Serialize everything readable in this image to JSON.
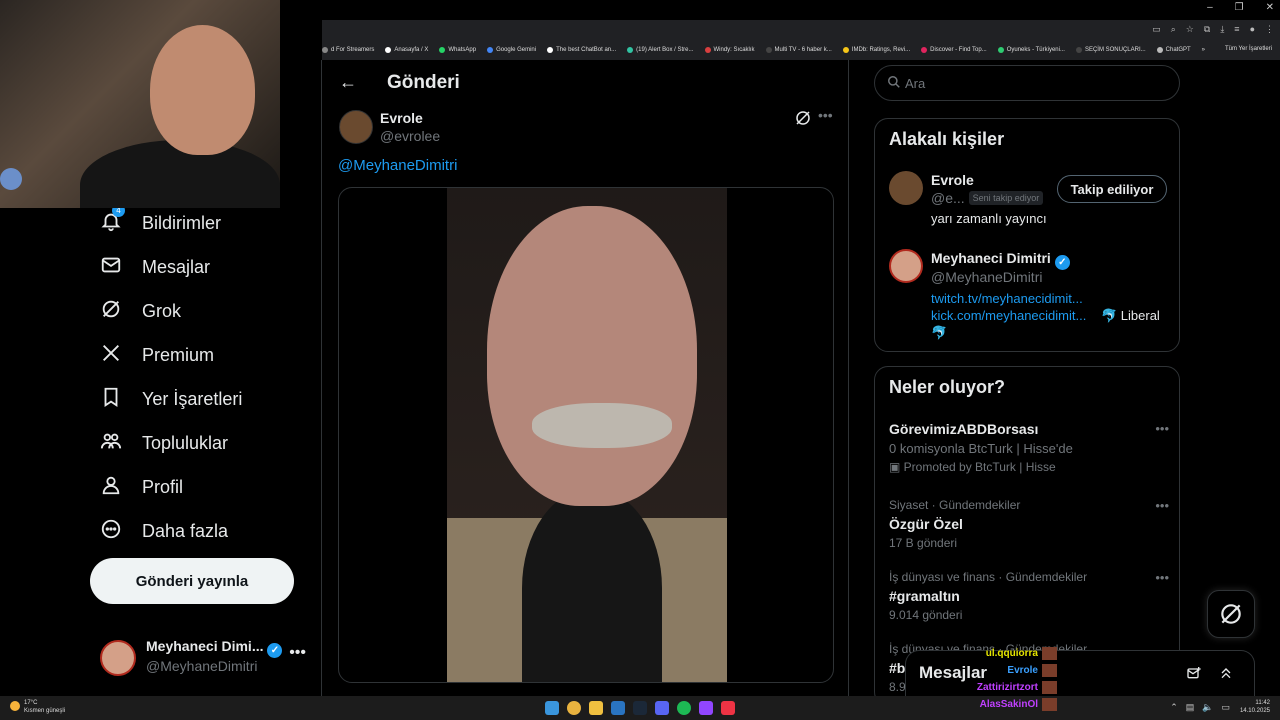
{
  "browser": {
    "bookmarks": [
      {
        "label": "d For Streamers",
        "color": "#888888"
      },
      {
        "label": "Anasayfa / X",
        "color": "#ffffff"
      },
      {
        "label": "WhatsApp",
        "color": "#25d366"
      },
      {
        "label": "Google Gemini",
        "color": "#4285f4"
      },
      {
        "label": "The best ChatBot an...",
        "color": "#ffffff"
      },
      {
        "label": "(19) Alert Box / Stre...",
        "color": "#31c3a2"
      },
      {
        "label": "Windy: Sıcaklık",
        "color": "#d83f3f"
      },
      {
        "label": "Multi TV - 6 haber k...",
        "color": "#444444"
      },
      {
        "label": "IMDb: Ratings, Revi...",
        "color": "#f5c518"
      },
      {
        "label": "Discover - Find Top...",
        "color": "#e0245e"
      },
      {
        "label": "Oyuneks - Türkiyeni...",
        "color": "#2ecc71"
      },
      {
        "label": "SEÇİM SONUÇLARI...",
        "color": "#444444"
      },
      {
        "label": "ChatGPT",
        "color": "#bbbbbb"
      }
    ],
    "bookmarks_more": "»",
    "all_bookmarks": "Tüm Yer İşaretleri"
  },
  "nav": {
    "items": [
      {
        "label": "Bildirimler",
        "icon": "bell-icon",
        "badge": "4"
      },
      {
        "label": "Mesajlar",
        "icon": "envelope-icon"
      },
      {
        "label": "Grok",
        "icon": "grok-icon"
      },
      {
        "label": "Premium",
        "icon": "x-logo-icon"
      },
      {
        "label": "Yer İşaretleri",
        "icon": "bookmark-icon"
      },
      {
        "label": "Topluluklar",
        "icon": "people-icon"
      },
      {
        "label": "Profil",
        "icon": "person-icon"
      },
      {
        "label": "Daha fazla",
        "icon": "more-circle-icon"
      }
    ],
    "post_button": "Gönderi yayınla",
    "account": {
      "name": "Meyhaneci Dimi...",
      "handle": "@MeyhaneDimitri"
    }
  },
  "post": {
    "header_title": "Gönderi",
    "author_name": "Evrole",
    "author_handle": "@evrolee",
    "mention": "@MeyhaneDimitri"
  },
  "sidebar": {
    "search_placeholder": "Ara",
    "related_title": "Alakalı kişiler",
    "people": [
      {
        "name": "Evrole",
        "handle": "@e...",
        "follows_you": "Seni takip ediyor",
        "bio": "yarı zamanlı yayıncı",
        "button": "Takip ediliyor"
      },
      {
        "name": "Meyhaneci Dimitri",
        "handle": "@MeyhaneDimitri",
        "link1": "twitch.tv/meyhanecidimit...",
        "link2": "kick.com/meyhanecidimit...",
        "bio_tail": "🐬 Liberal",
        "bio_tail2": "🐬"
      }
    ],
    "trends_title": "Neler oluyor?",
    "trends": [
      {
        "meta": "",
        "title": "GörevimizABDBorsası",
        "desc": "0 komisyonla BtcTurk | Hisse'de",
        "sub": "Promoted by BtcTurk | Hisse"
      },
      {
        "meta": "Siyaset · Gündemdekiler",
        "title": "Özgür Özel",
        "sub": "17 B gönderi"
      },
      {
        "meta": "İş dünyası ve finans · Gündemdekiler",
        "title": "#gramaltın",
        "sub": "9.014 gönderi"
      },
      {
        "meta": "İş dünyası ve finans · Gündemdekiler",
        "title": "#b",
        "sub": "8.9"
      }
    ]
  },
  "messages_drawer": {
    "title": "Mesajlar"
  },
  "stream_chat": [
    {
      "user": "ul.qquiorra",
      "color": "#e6e600"
    },
    {
      "user": "Evrole",
      "color": "#3aa0ff"
    },
    {
      "user": "Zattirizirtzort",
      "color": "#c040ff"
    },
    {
      "user": "AlasSakinOl",
      "color": "#c040ff"
    }
  ],
  "taskbar": {
    "weather_temp": "17°C",
    "weather_desc": "Kısmen güneşli",
    "time": "11:42",
    "date": "14.10.2025"
  }
}
